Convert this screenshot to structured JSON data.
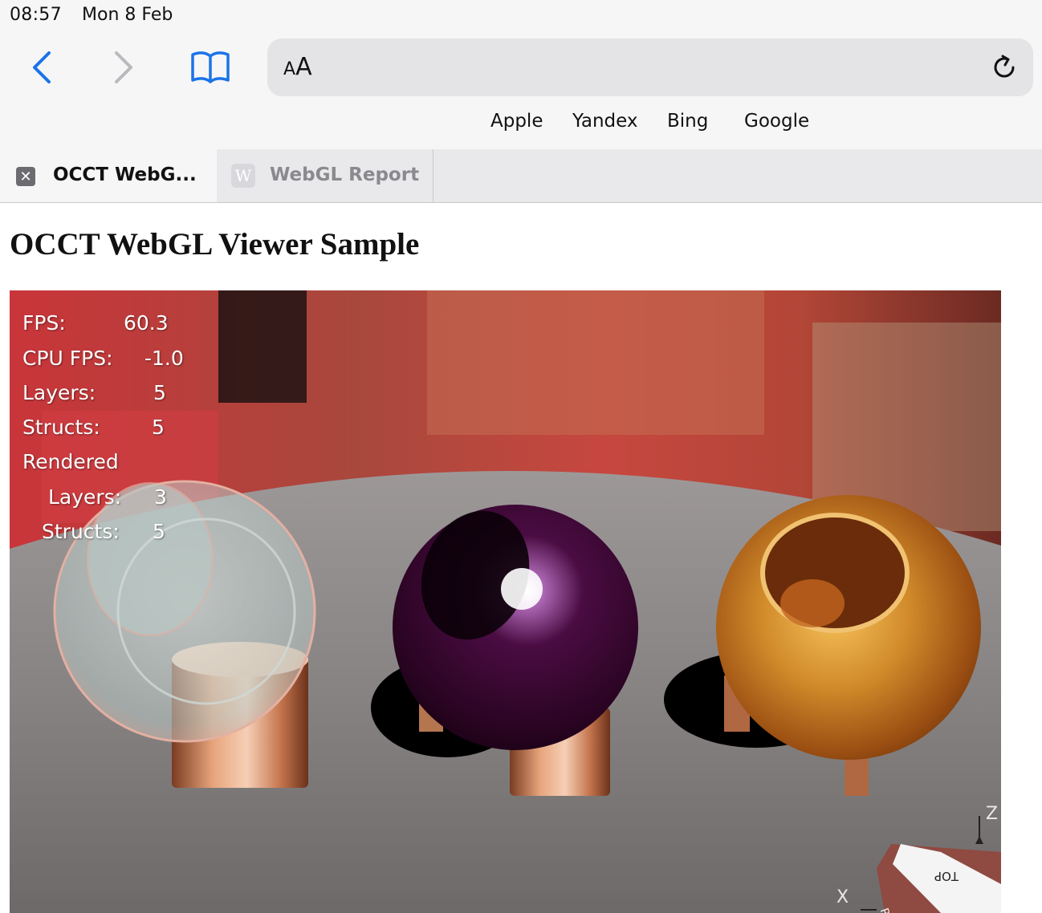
{
  "status_bar": {
    "time": "08:57",
    "date": "Mon 8 Feb"
  },
  "toolbar": {
    "back_icon": "chevron-left-icon",
    "forward_icon": "chevron-right-icon",
    "bookmarks_icon": "book-icon",
    "reload_icon": "reload-icon",
    "reader_label_small": "A",
    "reader_label_large": "A",
    "accent_color": "#1a73e8"
  },
  "favorites": [
    "Apple",
    "Yandex",
    "Bing",
    "Google"
  ],
  "tabs": [
    {
      "title": "OCCT WebG...",
      "icon": "close-icon",
      "icon_glyph": "✕",
      "active": true
    },
    {
      "title": "WebGL Report",
      "icon": "favicon-w",
      "icon_glyph": "W",
      "active": false
    }
  ],
  "page": {
    "title": "OCCT WebGL Viewer Sample"
  },
  "stats": {
    "fps_label": "FPS:",
    "fps_value": "60.3",
    "cpu_fps_label": "CPU FPS:",
    "cpu_fps_value": "-1.0",
    "layers_label": "Layers:",
    "layers_value": "5",
    "structs_label": "Structs:",
    "structs_value": "5",
    "rendered_label": "Rendered",
    "rendered_layers_label": "Layers:",
    "rendered_layers_value": "3",
    "rendered_structs_label": "Structs:",
    "rendered_structs_value": "5"
  },
  "view_cube": {
    "top_label": "TOP",
    "side_label": "RIG",
    "axis_z": "Z",
    "axis_x": "X"
  }
}
